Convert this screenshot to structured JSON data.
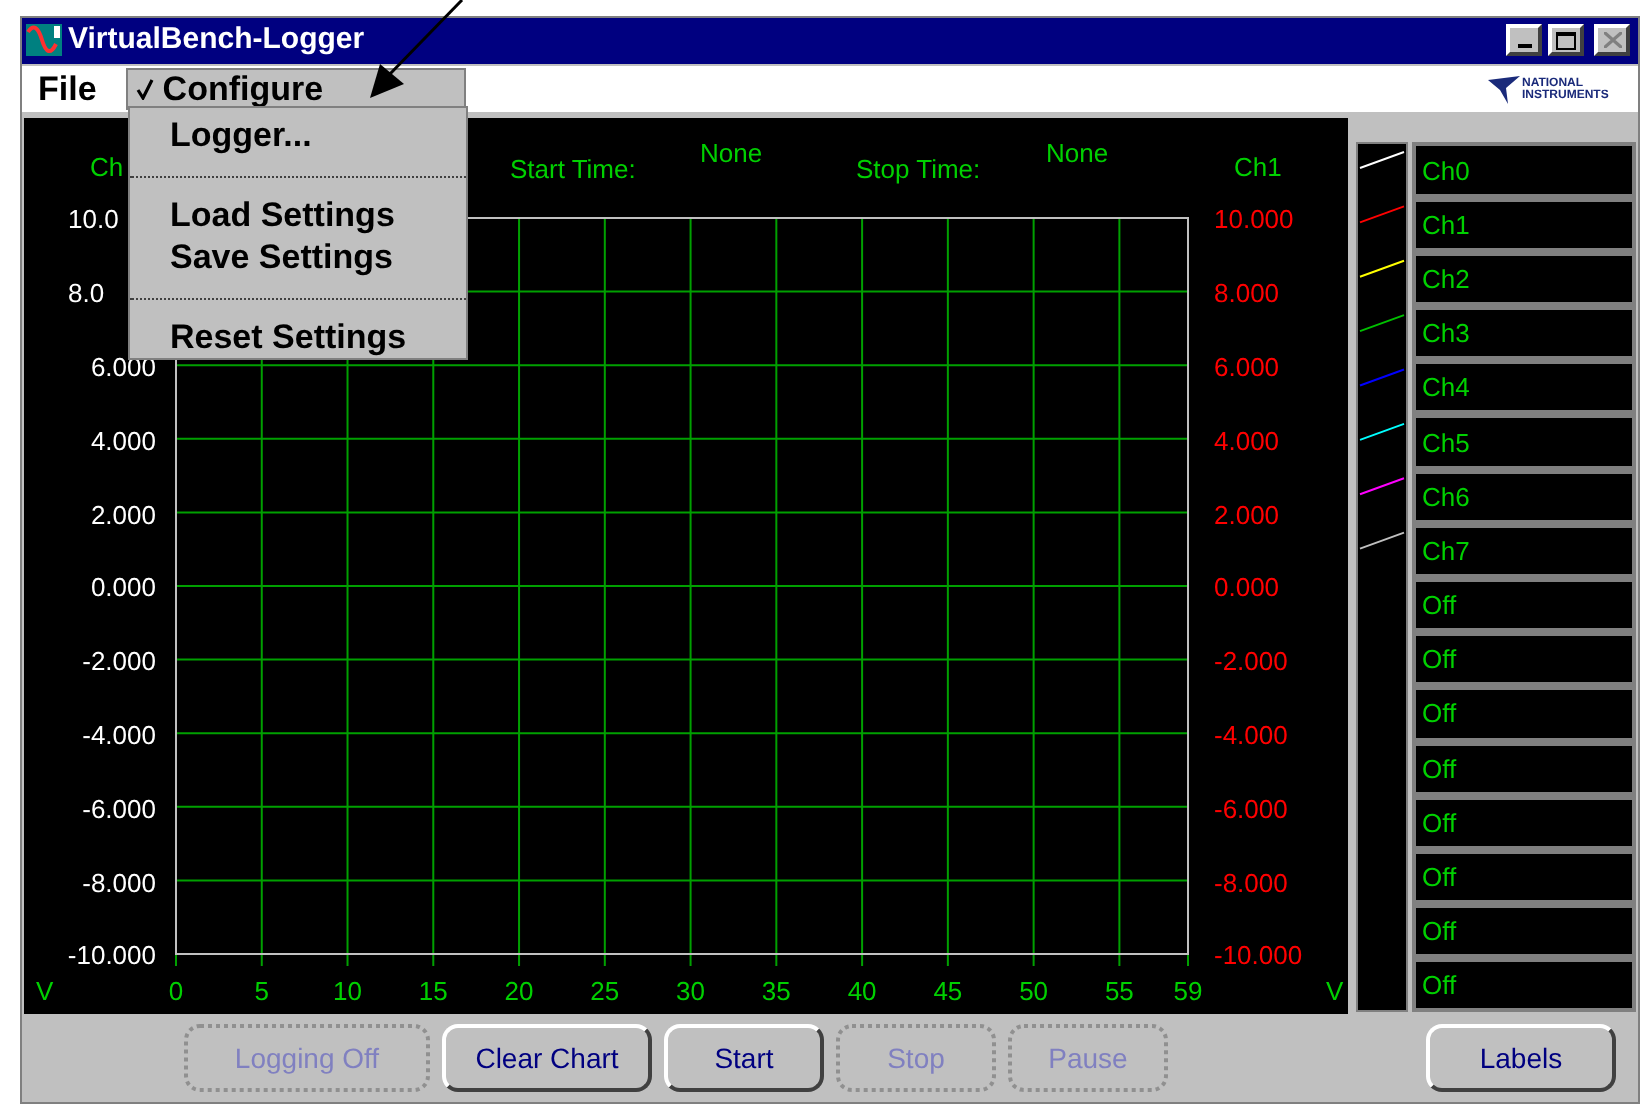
{
  "window": {
    "title": "VirtualBench-Logger",
    "close_disabled": true
  },
  "menu_bar": [
    {
      "label": "File",
      "selected": false,
      "checked": false
    },
    {
      "label": "Configure",
      "selected": true,
      "checked": true
    }
  ],
  "logo": {
    "text": "NATIONAL INSTRUMENTS"
  },
  "dropdown": [
    {
      "kind": "item",
      "label": "Logger..."
    },
    {
      "kind": "separator"
    },
    {
      "kind": "item",
      "label": "Load Settings"
    },
    {
      "kind": "item",
      "label": "Save Settings"
    },
    {
      "kind": "separator"
    },
    {
      "kind": "item",
      "label": "Reset Settings"
    }
  ],
  "chart": {
    "left_channel": "Ch",
    "start_label": "Start Time:",
    "start_value": "None",
    "stop_label": "Stop Time:",
    "stop_value": "None",
    "right_channel": "Ch1",
    "left_ticks": [
      {
        "label": "10.0",
        "clipped": true
      },
      {
        "label": "8.0",
        "clipped": true
      },
      {
        "label": "6.000",
        "clipped": false
      },
      {
        "label": "4.000",
        "clipped": false
      },
      {
        "label": "2.000",
        "clipped": false
      },
      {
        "label": "0.000",
        "clipped": false
      },
      {
        "label": "-2.000",
        "clipped": false
      },
      {
        "label": "-4.000",
        "clipped": false
      },
      {
        "label": "-6.000",
        "clipped": false
      },
      {
        "label": "-8.000",
        "clipped": false
      },
      {
        "label": "-10.000",
        "clipped": false
      }
    ],
    "right_ticks": [
      "10.000",
      "8.000",
      "6.000",
      "4.000",
      "2.000",
      "0.000",
      "-2.000",
      "-4.000",
      "-6.000",
      "-8.000",
      "-10.000"
    ],
    "x_ticks": [
      "0",
      "5",
      "10",
      "15",
      "20",
      "25",
      "30",
      "35",
      "40",
      "45",
      "50",
      "55",
      "59"
    ],
    "left_unit": "V",
    "right_unit": "V"
  },
  "legend": [
    {
      "label": "Ch0",
      "color": "#ffffff"
    },
    {
      "label": "Ch1",
      "color": "#ff0000"
    },
    {
      "label": "Ch2",
      "color": "#ffff00"
    },
    {
      "label": "Ch3",
      "color": "#00c000"
    },
    {
      "label": "Ch4",
      "color": "#0000ff"
    },
    {
      "label": "Ch5",
      "color": "#00ffff"
    },
    {
      "label": "Ch6",
      "color": "#ff00ff"
    },
    {
      "label": "Ch7",
      "color": "#c0c0c0"
    },
    {
      "label": "Off"
    },
    {
      "label": "Off"
    },
    {
      "label": "Off"
    },
    {
      "label": "Off"
    },
    {
      "label": "Off"
    },
    {
      "label": "Off"
    },
    {
      "label": "Off"
    },
    {
      "label": "Off"
    }
  ],
  "buttons": [
    {
      "label": "Logging Off",
      "disabled": true
    },
    {
      "label": "Clear Chart",
      "disabled": false
    },
    {
      "label": "Start",
      "disabled": false
    },
    {
      "label": "Stop",
      "disabled": true
    },
    {
      "label": "Pause",
      "disabled": true
    }
  ],
  "labels_button": {
    "label": "Labels",
    "disabled": false
  }
}
